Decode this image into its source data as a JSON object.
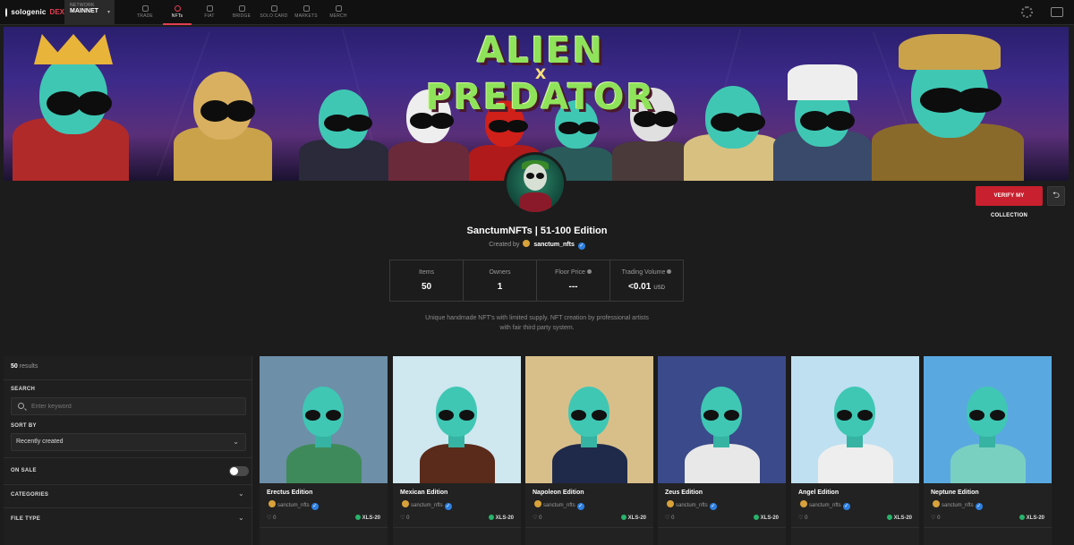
{
  "app": {
    "brand": "sologenic",
    "brand_suffix": "DEX"
  },
  "network": {
    "label": "NETWORK",
    "value": "MAINNET"
  },
  "nav": [
    {
      "label": "TRADE",
      "icon": "candlestick-icon",
      "active": false
    },
    {
      "label": "NFTs",
      "icon": "nft-icon",
      "active": true
    },
    {
      "label": "FIAT",
      "icon": "fiat-icon",
      "active": false
    },
    {
      "label": "BRIDGE",
      "icon": "bridge-icon",
      "active": false
    },
    {
      "label": "SOLO CARD",
      "icon": "card-icon",
      "active": false
    },
    {
      "label": "MARKETS",
      "icon": "markets-icon",
      "active": false
    },
    {
      "label": "MERCH",
      "icon": "merch-icon",
      "active": false
    }
  ],
  "banner": {
    "line1": "ALIEN",
    "x": "X",
    "line2": "PREDATOR"
  },
  "collection": {
    "verify_label": "VERIFY MY COLLECTION",
    "share_icon": "share-icon",
    "title": "SanctumNFTs | 51-100 Edition",
    "created_by_label": "Created by",
    "creator": "sanctum_nfts",
    "stats": [
      {
        "label": "Items",
        "value": "50",
        "info": false,
        "unit": ""
      },
      {
        "label": "Owners",
        "value": "1",
        "info": false,
        "unit": ""
      },
      {
        "label": "Floor Price",
        "value": "---",
        "info": true,
        "unit": ""
      },
      {
        "label": "Trading Volume",
        "value": "<0.01",
        "info": true,
        "unit": "USD"
      }
    ],
    "description_line1": "Unique handmade NFT's with limited supply. NFT creation by professional artists",
    "description_line2": "with fair third party system."
  },
  "filters": {
    "results_count": "50",
    "results_label": "results",
    "search_label": "SEARCH",
    "search_placeholder": "Enter keyword",
    "sort_label": "SORT BY",
    "sort_value": "Recently created",
    "on_sale_label": "ON SALE",
    "categories_label": "CATEGORIES",
    "file_type_label": "FILE TYPE"
  },
  "cards": [
    {
      "name": "Erectus Edition",
      "creator": "sanctum_nfts",
      "likes": "0",
      "standard": "XLS-20",
      "bg": "#6d8fa8",
      "outfit": "#3f8a5a"
    },
    {
      "name": "Mexican Edition",
      "creator": "sanctum_nfts",
      "likes": "0",
      "standard": "XLS-20",
      "bg": "#cfe7ef",
      "outfit": "#5a2a1a"
    },
    {
      "name": "Napoleon Edition",
      "creator": "sanctum_nfts",
      "likes": "0",
      "standard": "XLS-20",
      "bg": "#d8bf8a",
      "outfit": "#1f2a4a"
    },
    {
      "name": "Zeus Edition",
      "creator": "sanctum_nfts",
      "likes": "0",
      "standard": "XLS-20",
      "bg": "#3a4a8a",
      "outfit": "#e8e8e8"
    },
    {
      "name": "Angel Edition",
      "creator": "sanctum_nfts",
      "likes": "0",
      "standard": "XLS-20",
      "bg": "#bfe0f0",
      "outfit": "#eeeeee"
    },
    {
      "name": "Neptune Edition",
      "creator": "sanctum_nfts",
      "likes": "0",
      "standard": "XLS-20",
      "bg": "#5aa8e0",
      "outfit": "#7ad0c0"
    }
  ]
}
